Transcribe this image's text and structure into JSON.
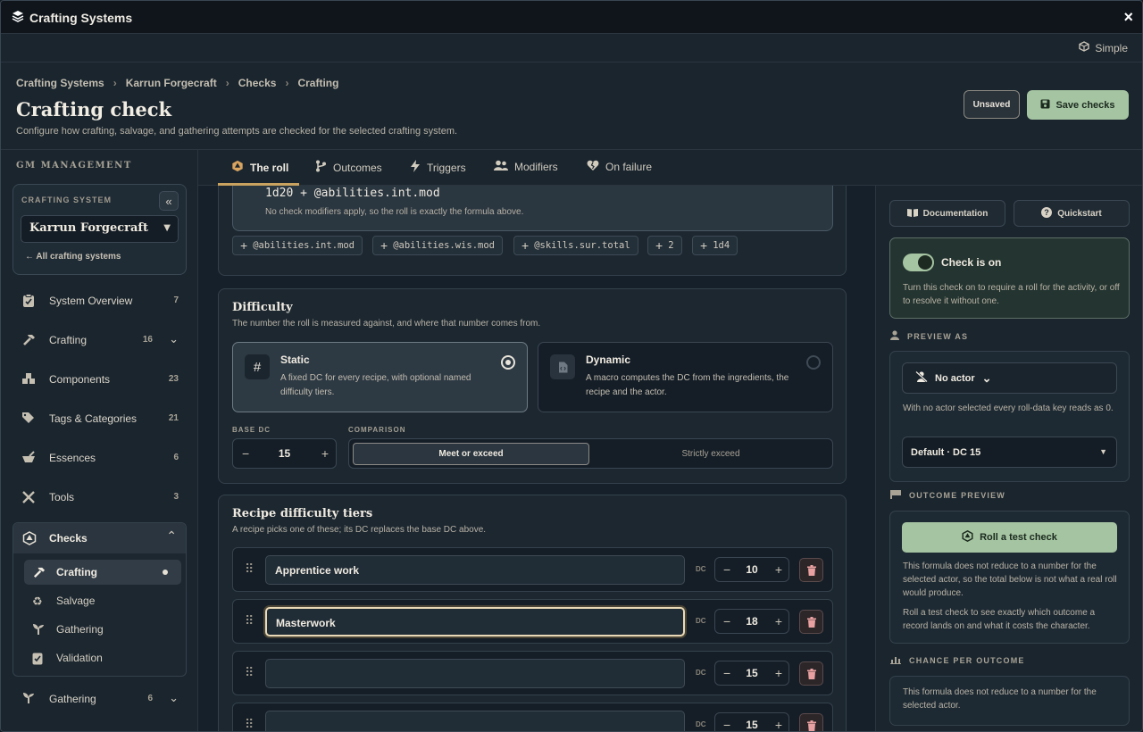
{
  "window": {
    "title": "Crafting Systems",
    "close_icon": "×"
  },
  "mode": {
    "label": "Simple"
  },
  "header": {
    "breadcrumbs": [
      "Crafting Systems",
      "Karrun Forgecraft",
      "Checks",
      "Crafting"
    ],
    "title": "Crafting check",
    "subtitle": "Configure how crafting, salvage, and gathering attempts are checked for the selected crafting system.",
    "unsaved_label": "Unsaved",
    "save_label": "Save checks"
  },
  "sidebar": {
    "section_label": "GM MANAGEMENT",
    "crafting_system_label": "CRAFTING SYSTEM",
    "crafting_system_value": "Karrun Forgecraft",
    "back_label": "All crafting systems",
    "items": [
      {
        "label": "System Overview",
        "count": "7"
      },
      {
        "label": "Crafting",
        "count": "16"
      },
      {
        "label": "Components",
        "count": "23"
      },
      {
        "label": "Tags & Categories",
        "count": "21"
      },
      {
        "label": "Essences",
        "count": "6"
      },
      {
        "label": "Tools",
        "count": "3"
      },
      {
        "label": "Checks",
        "count": ""
      },
      {
        "label": "Gathering",
        "count": "6"
      }
    ],
    "check_items": [
      {
        "label": "Crafting"
      },
      {
        "label": "Salvage"
      },
      {
        "label": "Gathering"
      },
      {
        "label": "Validation"
      }
    ]
  },
  "tabs": [
    {
      "label": "The roll"
    },
    {
      "label": "Outcomes"
    },
    {
      "label": "Triggers"
    },
    {
      "label": "Modifiers"
    },
    {
      "label": "On failure"
    }
  ],
  "roll": {
    "formula": "1d20 + @abilities.int.mod",
    "note": "No check modifiers apply, so the roll is exactly the formula above.",
    "chips": [
      "@abilities.int.mod",
      "@abilities.wis.mod",
      "@skills.sur.total",
      "2",
      "1d4"
    ]
  },
  "difficulty": {
    "title": "Difficulty",
    "subtitle": "The number the roll is measured against, and where that number comes from.",
    "options": [
      {
        "title": "Static",
        "desc": "A fixed DC for every recipe, with optional named difficulty tiers.",
        "selected": true
      },
      {
        "title": "Dynamic",
        "desc": "A macro computes the DC from the ingredients, the recipe and the actor.",
        "selected": false
      }
    ],
    "base_dc_label": "BASE DC",
    "base_dc": "15",
    "comparison_label": "COMPARISON",
    "comparison_options": [
      "Meet or exceed",
      "Strictly exceed"
    ],
    "comparison_selected": "Meet or exceed"
  },
  "tiers": {
    "title": "Recipe difficulty tiers",
    "subtitle": "A recipe picks one of these; its DC replaces the base DC above.",
    "dc_label": "DC",
    "rows": [
      {
        "name": "Apprentice work",
        "dc": "10"
      },
      {
        "name": "Masterwork",
        "dc": "18"
      },
      {
        "name": "",
        "dc": "15"
      },
      {
        "name": "",
        "dc": "15"
      }
    ]
  },
  "right": {
    "doc_label": "Documentation",
    "quick_label": "Quickstart",
    "check_on_title": "Check is on",
    "check_on_desc": "Turn this check on to require a roll for the activity, or off to resolve it without one.",
    "preview_label": "PREVIEW AS",
    "actor_value": "No actor",
    "actor_note": "With no actor selected every roll-data key reads as 0.",
    "dc_select": "Default · DC 15",
    "outcome_label": "OUTCOME PREVIEW",
    "roll_btn": "Roll a test check",
    "outcome_note1": "This formula does not reduce to a number for the selected actor, so the total below is not what a real roll would produce.",
    "outcome_note2": "Roll a test check to see exactly which outcome a record lands on and what it costs the character.",
    "chance_label": "CHANCE PER OUTCOME",
    "chance_note": "This formula does not reduce to a number for the selected actor."
  },
  "colors": {
    "accent": "#a5c4a1",
    "tab_underline": "#c9a25f",
    "danger": "#e9a0a0"
  }
}
